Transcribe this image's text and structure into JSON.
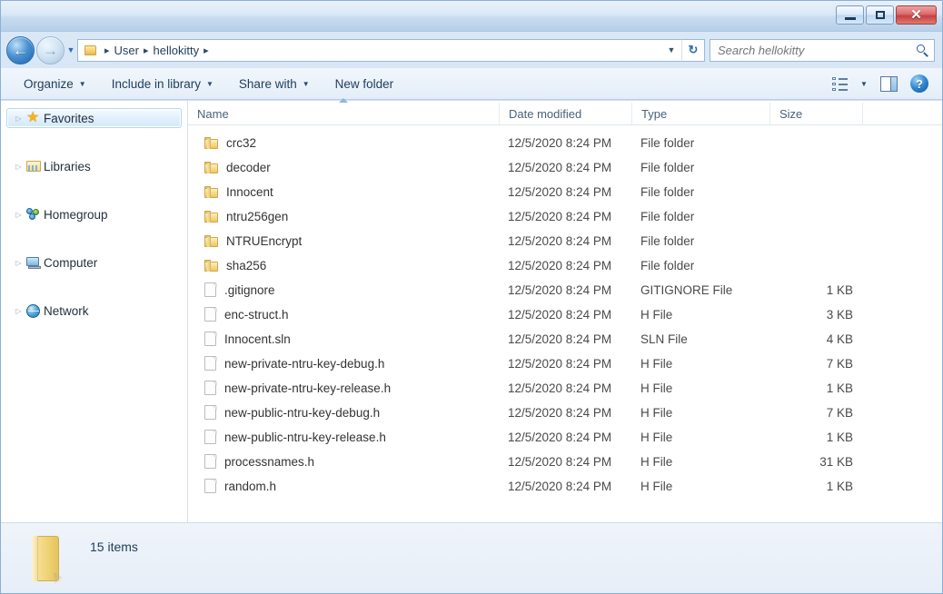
{
  "window": {
    "minimize_label": "Minimize",
    "maximize_label": "Maximize",
    "close_label": "✕"
  },
  "address": {
    "back_arrow": "←",
    "forward_arrow": "→",
    "recent_caret": "▼",
    "separator": "▸",
    "crumbs": [
      "User",
      "hellokitty"
    ],
    "dropdown_caret": "▼",
    "refresh_glyph": "↻"
  },
  "search": {
    "placeholder": "Search hellokitty",
    "value": ""
  },
  "toolbar": {
    "items": [
      {
        "label": "Organize",
        "caret": "▼"
      },
      {
        "label": "Include in library",
        "caret": "▼"
      },
      {
        "label": "Share with",
        "caret": "▼"
      },
      {
        "label": "New folder",
        "caret": ""
      }
    ],
    "views_caret": "▼",
    "help_glyph": "?"
  },
  "sidebar": {
    "items": [
      {
        "label": "Favorites",
        "icon": "star-icon",
        "expander": "▷",
        "selected": true
      },
      {
        "label": "Libraries",
        "icon": "libraries-icon",
        "expander": "▷",
        "selected": false
      },
      {
        "label": "Homegroup",
        "icon": "homegroup-icon",
        "expander": "▷",
        "selected": false
      },
      {
        "label": "Computer",
        "icon": "computer-icon",
        "expander": "▷",
        "selected": false
      },
      {
        "label": "Network",
        "icon": "network-icon",
        "expander": "▷",
        "selected": false
      }
    ]
  },
  "columns": {
    "name": "Name",
    "date_modified": "Date modified",
    "type": "Type",
    "size": "Size",
    "sorted_by": "Name",
    "sort_direction": "ascending"
  },
  "files": [
    {
      "name": "crc32",
      "date": "12/5/2020 8:24 PM",
      "type": "File folder",
      "size": "",
      "kind": "folder"
    },
    {
      "name": "decoder",
      "date": "12/5/2020 8:24 PM",
      "type": "File folder",
      "size": "",
      "kind": "folder"
    },
    {
      "name": "Innocent",
      "date": "12/5/2020 8:24 PM",
      "type": "File folder",
      "size": "",
      "kind": "folder"
    },
    {
      "name": "ntru256gen",
      "date": "12/5/2020 8:24 PM",
      "type": "File folder",
      "size": "",
      "kind": "folder"
    },
    {
      "name": "NTRUEncrypt",
      "date": "12/5/2020 8:24 PM",
      "type": "File folder",
      "size": "",
      "kind": "folder"
    },
    {
      "name": "sha256",
      "date": "12/5/2020 8:24 PM",
      "type": "File folder",
      "size": "",
      "kind": "folder"
    },
    {
      "name": ".gitignore",
      "date": "12/5/2020 8:24 PM",
      "type": "GITIGNORE File",
      "size": "1 KB",
      "kind": "file"
    },
    {
      "name": "enc-struct.h",
      "date": "12/5/2020 8:24 PM",
      "type": "H File",
      "size": "3 KB",
      "kind": "file"
    },
    {
      "name": "Innocent.sln",
      "date": "12/5/2020 8:24 PM",
      "type": "SLN File",
      "size": "4 KB",
      "kind": "file"
    },
    {
      "name": "new-private-ntru-key-debug.h",
      "date": "12/5/2020 8:24 PM",
      "type": "H File",
      "size": "7 KB",
      "kind": "file"
    },
    {
      "name": "new-private-ntru-key-release.h",
      "date": "12/5/2020 8:24 PM",
      "type": "H File",
      "size": "1 KB",
      "kind": "file"
    },
    {
      "name": "new-public-ntru-key-debug.h",
      "date": "12/5/2020 8:24 PM",
      "type": "H File",
      "size": "7 KB",
      "kind": "file"
    },
    {
      "name": "new-public-ntru-key-release.h",
      "date": "12/5/2020 8:24 PM",
      "type": "H File",
      "size": "1 KB",
      "kind": "file"
    },
    {
      "name": "processnames.h",
      "date": "12/5/2020 8:24 PM",
      "type": "H File",
      "size": "31 KB",
      "kind": "file"
    },
    {
      "name": "random.h",
      "date": "12/5/2020 8:24 PM",
      "type": "H File",
      "size": "1 KB",
      "kind": "file"
    }
  ],
  "status": {
    "item_count": "15 items"
  },
  "colors": {
    "accent": "#2f6ead",
    "close_button": "#c64040",
    "folder_yellow": "#f0d275",
    "selection": "#d4e9fa"
  }
}
